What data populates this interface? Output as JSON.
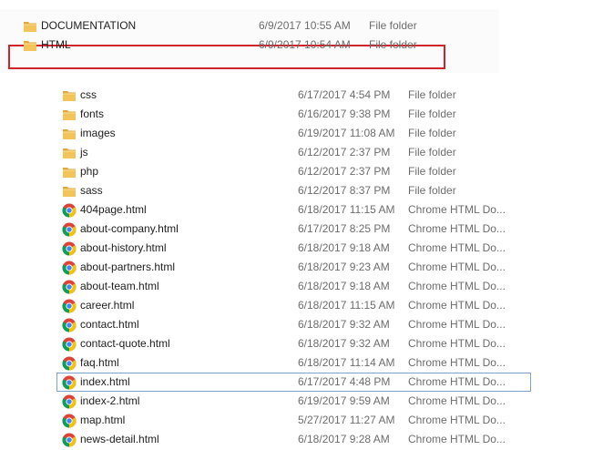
{
  "top_list": {
    "rows": [
      {
        "name": "DOCUMENTATION",
        "date": "6/9/2017 10:55 AM",
        "type": "File folder",
        "icon": "folder-icon"
      },
      {
        "name": "HTML",
        "date": "6/9/2017 10:54 AM",
        "type": "File folder",
        "icon": "folder-icon"
      }
    ],
    "highlight_color": "#d0242c"
  },
  "file_list": {
    "rows": [
      {
        "name": "css",
        "date": "6/17/2017 4:54 PM",
        "type": "File folder",
        "icon": "folder-icon"
      },
      {
        "name": "fonts",
        "date": "6/16/2017 9:38 PM",
        "type": "File folder",
        "icon": "folder-icon"
      },
      {
        "name": "images",
        "date": "6/19/2017 11:08 AM",
        "type": "File folder",
        "icon": "folder-icon"
      },
      {
        "name": "js",
        "date": "6/12/2017 2:37 PM",
        "type": "File folder",
        "icon": "folder-icon"
      },
      {
        "name": "php",
        "date": "6/12/2017 2:37 PM",
        "type": "File folder",
        "icon": "folder-icon"
      },
      {
        "name": "sass",
        "date": "6/12/2017 8:37 PM",
        "type": "File folder",
        "icon": "folder-icon"
      },
      {
        "name": "404page.html",
        "date": "6/18/2017 11:15 AM",
        "type": "Chrome HTML Do...",
        "icon": "chrome-icon"
      },
      {
        "name": "about-company.html",
        "date": "6/17/2017 8:25 PM",
        "type": "Chrome HTML Do...",
        "icon": "chrome-icon"
      },
      {
        "name": "about-history.html",
        "date": "6/18/2017 9:18 AM",
        "type": "Chrome HTML Do...",
        "icon": "chrome-icon"
      },
      {
        "name": "about-partners.html",
        "date": "6/18/2017 9:23 AM",
        "type": "Chrome HTML Do...",
        "icon": "chrome-icon"
      },
      {
        "name": "about-team.html",
        "date": "6/18/2017 9:18 AM",
        "type": "Chrome HTML Do...",
        "icon": "chrome-icon"
      },
      {
        "name": "career.html",
        "date": "6/18/2017 11:15 AM",
        "type": "Chrome HTML Do...",
        "icon": "chrome-icon"
      },
      {
        "name": "contact.html",
        "date": "6/18/2017 9:32 AM",
        "type": "Chrome HTML Do...",
        "icon": "chrome-icon"
      },
      {
        "name": "contact-quote.html",
        "date": "6/18/2017 9:32 AM",
        "type": "Chrome HTML Do...",
        "icon": "chrome-icon"
      },
      {
        "name": "faq.html",
        "date": "6/18/2017 11:14 AM",
        "type": "Chrome HTML Do...",
        "icon": "chrome-icon"
      },
      {
        "name": "index.html",
        "date": "6/17/2017 4:48 PM",
        "type": "Chrome HTML Do...",
        "icon": "chrome-icon",
        "focused": true
      },
      {
        "name": "index-2.html",
        "date": "6/19/2017 9:59 AM",
        "type": "Chrome HTML Do...",
        "icon": "chrome-icon"
      },
      {
        "name": "map.html",
        "date": "5/27/2017 11:27 AM",
        "type": "Chrome HTML Do...",
        "icon": "chrome-icon"
      },
      {
        "name": "news-detail.html",
        "date": "6/18/2017 9:28 AM",
        "type": "Chrome HTML Do...",
        "icon": "chrome-icon"
      }
    ]
  },
  "colors": {
    "folder_body": "#f3c45a",
    "folder_tab": "#e2a93a",
    "secondary_text": "#6d6d6d",
    "focus_border": "#7da2ce"
  }
}
